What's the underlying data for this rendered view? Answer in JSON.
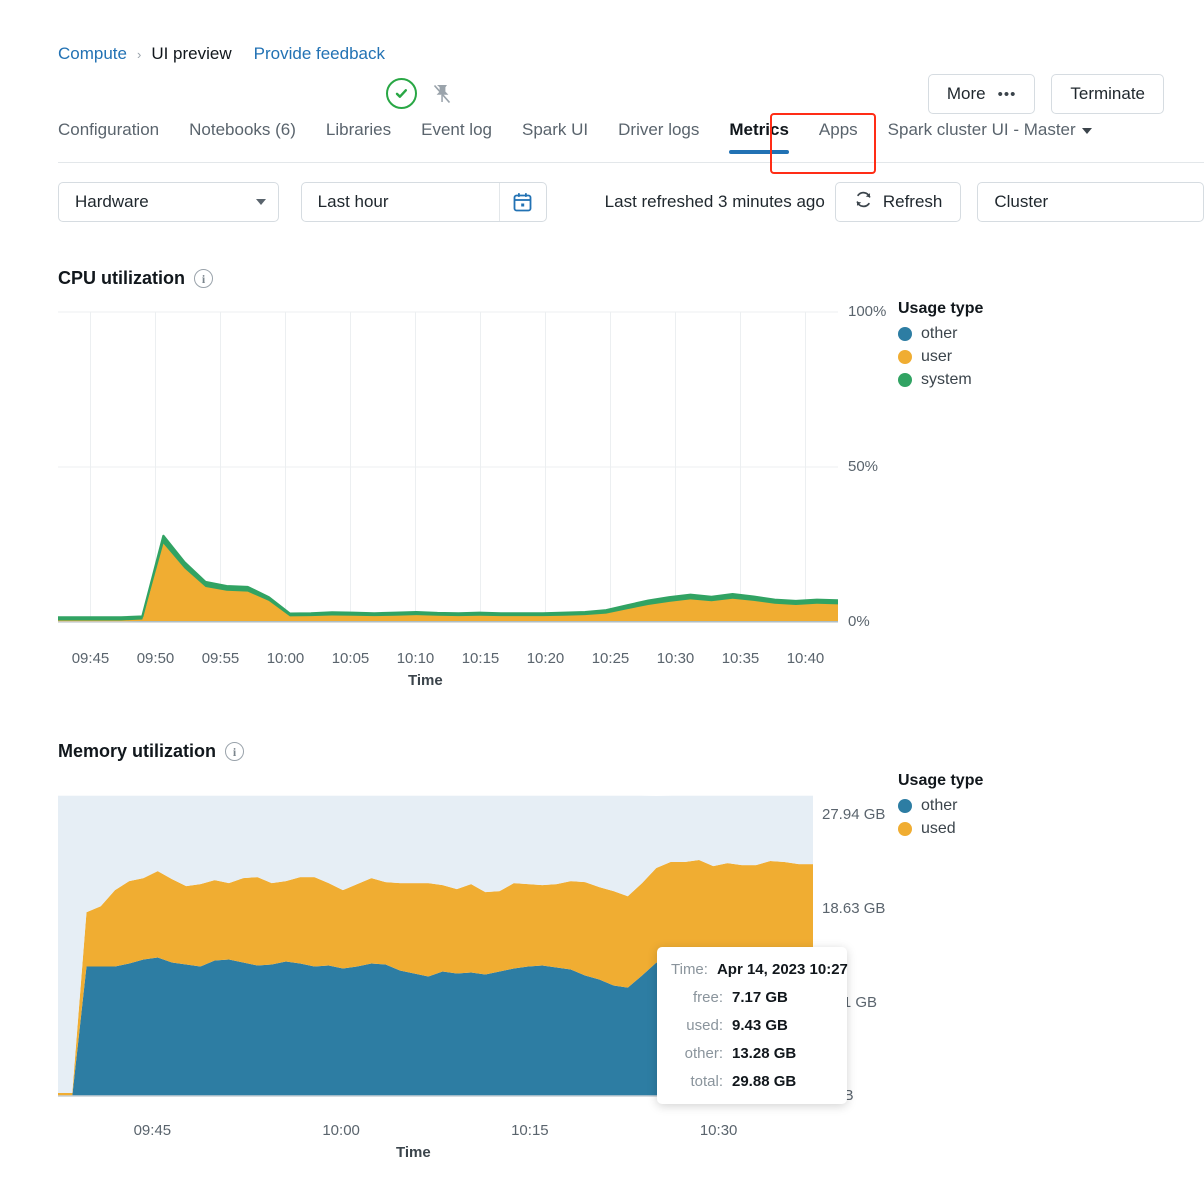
{
  "breadcrumb": {
    "root": "Compute",
    "separator": "›",
    "current": "UI preview",
    "feedback": "Provide feedback"
  },
  "status": {
    "state_icon": "check-circle-icon",
    "pin_icon": "pin-off-icon"
  },
  "top_actions": {
    "more_label": "More",
    "more_dots": "•••",
    "terminate_label": "Terminate"
  },
  "tabs": [
    {
      "label": "Configuration",
      "active": false
    },
    {
      "label": "Notebooks (6)",
      "active": false
    },
    {
      "label": "Libraries",
      "active": false
    },
    {
      "label": "Event log",
      "active": false
    },
    {
      "label": "Spark UI",
      "active": false
    },
    {
      "label": "Driver logs",
      "active": false
    },
    {
      "label": "Metrics",
      "active": true
    },
    {
      "label": "Apps",
      "active": false
    },
    {
      "label": "Spark cluster UI - Master",
      "active": false
    }
  ],
  "toolbar": {
    "hardware_select": "Hardware",
    "time_range": "Last hour",
    "calendar_icon": "calendar-icon",
    "last_refreshed": "Last refreshed 3 minutes ago",
    "refresh_label": "Refresh",
    "refresh_icon": "refresh-icon",
    "cluster_select": "Cluster"
  },
  "cpu_section": {
    "title": "CPU utilization",
    "info_icon": "info-icon"
  },
  "memory_section": {
    "title": "Memory utilization",
    "info_icon": "info-icon"
  },
  "tooltip": {
    "rows": [
      {
        "key": "Time:",
        "value": "Apr 14, 2023 10:27"
      },
      {
        "key": "free:",
        "value": "7.17 GB"
      },
      {
        "key": "used:",
        "value": "9.43 GB"
      },
      {
        "key": "other:",
        "value": "13.28 GB"
      },
      {
        "key": "total:",
        "value": "29.88 GB"
      }
    ]
  },
  "colors": {
    "other": "#2d7da3",
    "user": "#f0ad32",
    "used": "#f0ad32",
    "system": "#31a363",
    "free_band": "#e6eef5",
    "accent": "#2272b4",
    "highlight": "#ff2d16"
  },
  "chart_data": [
    {
      "type": "area",
      "id": "cpu-utilization",
      "title": "CPU utilization",
      "xlabel": "Time",
      "ylabel": "",
      "stacked": true,
      "grid": true,
      "legend_position": "right",
      "legend_title": "Usage type",
      "ylim": [
        0,
        100
      ],
      "yticks": [
        "0%",
        "50%",
        "100%"
      ],
      "ytick_values": [
        0,
        50,
        100
      ],
      "xticks": [
        "09:45",
        "09:50",
        "09:55",
        "10:00",
        "10:05",
        "10:10",
        "10:15",
        "10:20",
        "10:25",
        "10:30",
        "10:35",
        "10:40"
      ],
      "x": [
        "09:43",
        "09:45",
        "09:47",
        "09:49",
        "09:50",
        "09:51",
        "09:52",
        "09:53",
        "09:54",
        "09:55",
        "09:56",
        "09:58",
        "10:00",
        "10:02",
        "10:04",
        "10:06",
        "10:08",
        "10:10",
        "10:12",
        "10:14",
        "10:16",
        "10:18",
        "10:20",
        "10:22",
        "10:24",
        "10:26",
        "10:28",
        "10:30",
        "10:31",
        "10:32",
        "10:33",
        "10:34",
        "10:35",
        "10:36",
        "10:37",
        "10:38",
        "10:39",
        "10:40"
      ],
      "series": [
        {
          "name": "other",
          "color": "#2d7da3",
          "values": [
            0.2,
            0.2,
            0.2,
            0.2,
            0.3,
            0.3,
            0.3,
            0.3,
            0.3,
            0.3,
            0.3,
            0.3,
            0.3,
            0.3,
            0.3,
            0.3,
            0.3,
            0.3,
            0.3,
            0.3,
            0.3,
            0.3,
            0.3,
            0.3,
            0.3,
            0.3,
            0.3,
            0.3,
            0.3,
            0.3,
            0.3,
            0.3,
            0.3,
            0.3,
            0.3,
            0.3,
            0.3,
            0.3
          ]
        },
        {
          "name": "user",
          "color": "#f0ad32",
          "values": [
            0.3,
            0.3,
            0.3,
            0.3,
            0.5,
            25.0,
            17.0,
            11.0,
            9.8,
            9.5,
            6.5,
            1.5,
            1.6,
            1.8,
            1.7,
            1.6,
            1.7,
            1.9,
            1.7,
            1.6,
            1.7,
            1.6,
            1.6,
            1.6,
            1.7,
            1.9,
            2.4,
            3.8,
            5.2,
            6.2,
            7.0,
            6.4,
            7.2,
            6.5,
            5.6,
            5.2,
            5.6,
            5.4
          ]
        },
        {
          "name": "system",
          "color": "#31a363",
          "values": [
            1.0,
            1.0,
            1.0,
            1.0,
            1.0,
            2.5,
            2.0,
            1.6,
            1.5,
            1.5,
            1.2,
            0.9,
            0.9,
            1.0,
            1.0,
            0.9,
            1.0,
            1.0,
            0.9,
            0.9,
            1.0,
            0.9,
            0.9,
            0.9,
            1.0,
            1.0,
            1.1,
            1.3,
            1.4,
            1.5,
            1.5,
            1.4,
            1.5,
            1.4,
            1.3,
            1.3,
            1.3,
            1.3
          ]
        }
      ]
    },
    {
      "type": "area",
      "id": "memory-utilization",
      "title": "Memory utilization",
      "xlabel": "Time",
      "ylabel": "",
      "stacked": true,
      "grid": true,
      "legend_position": "right",
      "legend_title": "Usage type",
      "ylim_bytes": [
        0,
        29.88
      ],
      "yticks": [
        "0 B",
        "9.31 GB",
        "18.63 GB",
        "27.94 GB"
      ],
      "ytick_values": [
        0,
        9.31,
        18.63,
        27.94
      ],
      "xticks": [
        "09:45",
        "10:00",
        "10:15",
        "10:30"
      ],
      "unit": "GB",
      "total_gb": 29.88,
      "x": [
        "09:43",
        "09:45",
        "09:47",
        "09:48",
        "09:49",
        "09:50",
        "09:51",
        "09:52",
        "09:53",
        "09:54",
        "09:55",
        "09:56",
        "09:57",
        "09:58",
        "09:59",
        "10:00",
        "10:01",
        "10:02",
        "10:03",
        "10:04",
        "10:05",
        "10:06",
        "10:07",
        "10:08",
        "10:09",
        "10:10",
        "10:11",
        "10:12",
        "10:13",
        "10:14",
        "10:15",
        "10:16",
        "10:17",
        "10:18",
        "10:19",
        "10:20",
        "10:21",
        "10:22",
        "10:23",
        "10:24",
        "10:25",
        "10:26",
        "10:27",
        "10:28",
        "10:29",
        "10:30",
        "10:31",
        "10:32",
        "10:33",
        "10:34",
        "10:35",
        "10:36",
        "10:37",
        "10:38"
      ],
      "series": [
        {
          "name": "other",
          "color": "#2d7da3",
          "values": [
            0,
            0,
            12.9,
            12.9,
            12.9,
            13.2,
            13.6,
            13.8,
            13.3,
            13.1,
            12.9,
            13.5,
            13.6,
            13.3,
            13.0,
            13.1,
            13.4,
            13.2,
            12.9,
            13.0,
            12.7,
            12.9,
            13.2,
            13.1,
            12.5,
            12.2,
            11.9,
            12.4,
            12.2,
            12.3,
            12.1,
            12.4,
            12.7,
            12.9,
            13.0,
            12.8,
            12.6,
            12.0,
            11.6,
            11.0,
            10.8,
            12.0,
            13.28,
            13.4,
            13.5,
            13.3,
            13.1,
            12.9,
            13.4,
            13.6,
            13.5,
            13.3,
            13.4,
            13.3
          ]
        },
        {
          "name": "used",
          "color": "#f0ad32",
          "values": [
            0.3,
            0.3,
            5.4,
            6.0,
            7.6,
            8.2,
            8.1,
            8.6,
            8.3,
            7.8,
            8.2,
            8.0,
            7.6,
            8.4,
            8.8,
            8.1,
            8.0,
            8.6,
            8.9,
            8.2,
            7.8,
            8.2,
            8.5,
            8.2,
            8.7,
            9.0,
            9.3,
            8.6,
            8.4,
            8.8,
            8.2,
            8.0,
            8.5,
            8.2,
            8.0,
            8.3,
            8.8,
            9.3,
            9.2,
            9.4,
            9.1,
            9.2,
            9.43,
            9.9,
            9.8,
            10.2,
            9.8,
            10.3,
            9.6,
            9.4,
            9.9,
            10.0,
            9.7,
            9.8
          ]
        },
        {
          "name": "free",
          "color": "#e6eef5",
          "values": [
            29.6,
            29.6,
            11.6,
            11.0,
            9.4,
            8.5,
            8.2,
            7.5,
            8.3,
            9.0,
            8.8,
            8.4,
            8.7,
            8.2,
            8.1,
            8.7,
            8.5,
            8.1,
            8.1,
            8.7,
            9.4,
            8.8,
            8.2,
            8.6,
            8.7,
            8.7,
            8.7,
            8.9,
            9.3,
            8.8,
            9.6,
            9.5,
            8.7,
            8.8,
            8.9,
            8.8,
            8.5,
            8.6,
            9.1,
            9.5,
            10.0,
            8.7,
            7.17,
            6.6,
            6.6,
            6.4,
            7.0,
            6.7,
            6.9,
            6.9,
            6.5,
            6.6,
            6.8,
            6.8
          ]
        }
      ]
    }
  ]
}
